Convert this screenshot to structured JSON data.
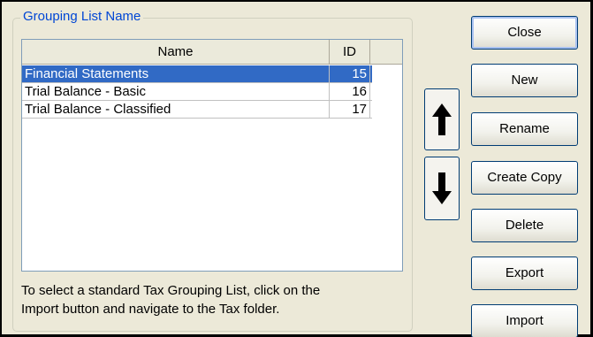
{
  "group": {
    "label": "Grouping List Name"
  },
  "list": {
    "headers": {
      "name": "Name",
      "id": "ID"
    },
    "rows": [
      {
        "name": "Financial Statements",
        "id": "15",
        "selected": true
      },
      {
        "name": "Trial Balance - Basic",
        "id": "16",
        "selected": false
      },
      {
        "name": "Trial Balance - Classified",
        "id": "17",
        "selected": false
      }
    ]
  },
  "hint": {
    "line1": "To select a standard Tax Grouping List, click on the",
    "line2": "Import button and navigate to the Tax folder."
  },
  "buttons": {
    "close": "Close",
    "new": "New",
    "rename": "Rename",
    "create_copy": "Create Copy",
    "delete": "Delete",
    "export": "Export",
    "import": "Import"
  },
  "icons": {
    "move_up": "arrow-up-icon",
    "move_down": "arrow-down-icon"
  },
  "colors": {
    "selection": "#316ac5",
    "group_label": "#0046d5",
    "window_bg": "#ece9d8"
  }
}
